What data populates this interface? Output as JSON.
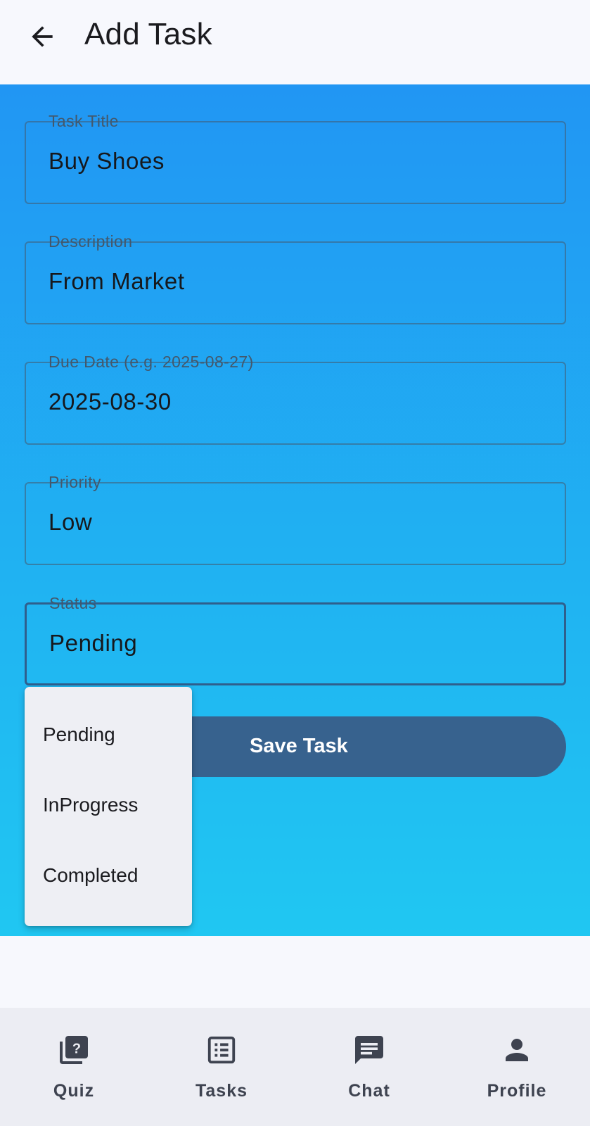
{
  "header": {
    "title": "Add Task",
    "back_icon": "arrow-back-icon"
  },
  "form": {
    "fields": [
      {
        "label": "Task Title",
        "value": "Buy Shoes"
      },
      {
        "label": "Description",
        "value": "From Market"
      },
      {
        "label": "Due Date (e.g. 2025-08-27)",
        "value": "2025-08-30"
      },
      {
        "label": "Priority",
        "value": "Low"
      },
      {
        "label": "Status",
        "value": "Pending"
      }
    ],
    "save_label": "Save Task"
  },
  "status_menu": {
    "options": [
      "Pending",
      "InProgress",
      "Completed"
    ]
  },
  "bottom_nav": {
    "items": [
      {
        "label": "Quiz",
        "icon": "quiz-icon"
      },
      {
        "label": "Tasks",
        "icon": "list-icon"
      },
      {
        "label": "Chat",
        "icon": "chat-icon"
      },
      {
        "label": "Profile",
        "icon": "person-icon"
      }
    ]
  },
  "colors": {
    "gradient_top": "#2196f3",
    "gradient_bottom": "#20c7f2",
    "primary": "#37628e",
    "nav_background": "#ecedf3"
  }
}
